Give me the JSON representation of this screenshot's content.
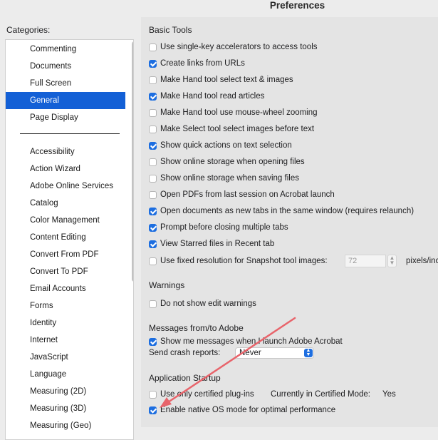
{
  "window": {
    "title": "Preferences"
  },
  "categories": {
    "label": "Categories:",
    "top_items": [
      "Commenting",
      "Documents",
      "Full Screen",
      "General",
      "Page Display"
    ],
    "selected": "General",
    "items": [
      "Accessibility",
      "Action Wizard",
      "Adobe Online Services",
      "Catalog",
      "Color Management",
      "Content Editing",
      "Convert From PDF",
      "Convert To PDF",
      "Email Accounts",
      "Forms",
      "Identity",
      "Internet",
      "JavaScript",
      "Language",
      "Measuring (2D)",
      "Measuring (3D)",
      "Measuring (Geo)"
    ]
  },
  "basic_tools": {
    "heading": "Basic Tools",
    "options": [
      {
        "label": "Use single-key accelerators to access tools",
        "checked": false
      },
      {
        "label": "Create links from URLs",
        "checked": true
      },
      {
        "label": "Make Hand tool select text & images",
        "checked": false
      },
      {
        "label": "Make Hand tool read articles",
        "checked": true
      },
      {
        "label": "Make Hand tool use mouse-wheel zooming",
        "checked": false
      },
      {
        "label": "Make Select tool select images before text",
        "checked": false
      },
      {
        "label": "Show quick actions on text selection",
        "checked": true
      },
      {
        "label": "Show online storage when opening files",
        "checked": false
      },
      {
        "label": "Show online storage when saving files",
        "checked": false
      },
      {
        "label": "Open PDFs from last session on Acrobat launch",
        "checked": false
      },
      {
        "label": "Open documents as new tabs in the same window (requires relaunch)",
        "checked": true
      },
      {
        "label": "Prompt before closing multiple tabs",
        "checked": true
      },
      {
        "label": "View Starred files in Recent tab",
        "checked": true
      },
      {
        "label": "Use fixed resolution for Snapshot tool images:",
        "checked": false
      }
    ],
    "snapshot_value": "72",
    "snapshot_unit": "pixels/inch"
  },
  "warnings": {
    "heading": "Warnings",
    "options": [
      {
        "label": "Do not show edit warnings",
        "checked": false
      }
    ]
  },
  "messages": {
    "heading": "Messages from/to Adobe",
    "options": [
      {
        "label": "Show me messages when I launch Adobe Acrobat",
        "checked": true
      }
    ],
    "crash_label": "Send crash reports:",
    "crash_value": "Never"
  },
  "startup": {
    "heading": "Application Startup",
    "options": [
      {
        "label": "Use only certified plug-ins",
        "checked": false
      },
      {
        "label": "Enable native OS mode for optimal performance",
        "checked": true
      }
    ],
    "cert_mode_label": "Currently in Certified Mode:",
    "cert_mode_value": "Yes"
  },
  "colors": {
    "selection": "#1360d6",
    "checkbox": "#1d6ee0",
    "annotation_arrow": "#e8646b"
  }
}
